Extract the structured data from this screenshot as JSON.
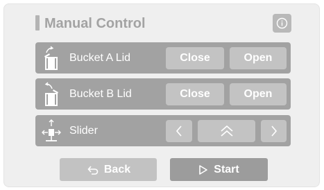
{
  "panel": {
    "title": "Manual Control",
    "info_icon": "info-icon"
  },
  "rows": [
    {
      "label": "Bucket A Lid",
      "icon": "bucket-lid-icon",
      "close_label": "Close",
      "open_label": "Open"
    },
    {
      "label": "Bucket B Lid",
      "icon": "bucket-lid-icon",
      "close_label": "Close",
      "open_label": "Open"
    },
    {
      "label": "Slider",
      "icon": "slider-move-icon",
      "left_icon": "chevron-left-icon",
      "up_icon": "double-chevron-up-icon",
      "right_icon": "chevron-right-icon"
    }
  ],
  "footer": {
    "back_label": "Back",
    "back_icon": "undo-arrow-icon",
    "start_label": "Start",
    "start_icon": "play-icon"
  },
  "colors": {
    "panel_bg": "#efefef",
    "row_bg": "#a2a2a2",
    "button_bg": "#c3c3c3",
    "start_bg": "#9c9c9c",
    "text_light": "#ffffff",
    "title": "#a3a3a3"
  }
}
